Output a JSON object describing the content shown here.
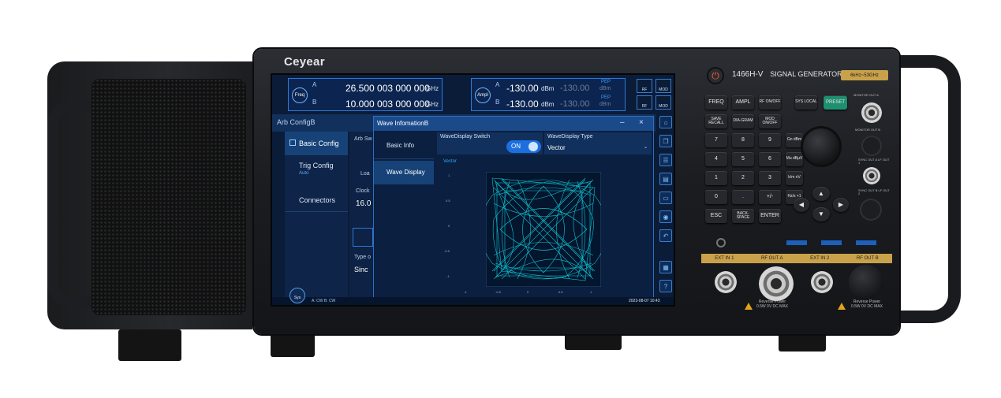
{
  "device": {
    "brand": "Ceyear",
    "model": "1466H-V",
    "model_suffix": "SIGNAL GENERATOR",
    "freq_range": "6kHz~53GHz"
  },
  "screen": {
    "freq": {
      "badge": "Freq",
      "a_label": "A",
      "a_value": "26.500 003 000 000",
      "a_unit": "GHz",
      "b_label": "B",
      "b_value": "10.000 003 000 000",
      "b_unit": "GHz"
    },
    "ampl": {
      "badge": "Ampl",
      "a_label": "A",
      "a_value": "-130.00",
      "a_unit": "dBm",
      "a_pep_label": "PEP",
      "a_pep_value": "-130.00",
      "a_pep_unit": "dBm",
      "b_label": "B",
      "b_value": "-130.00",
      "b_unit": "dBm",
      "b_pep_label": "PEP",
      "b_pep_value": "-130.00",
      "b_pep_unit": "dBm"
    },
    "mini_buttons": {
      "a_rf": "RF",
      "a_mod": "MOD",
      "b_rf": "RF",
      "b_mod": "MOD",
      "a_tag": "A",
      "b_tag": "B"
    },
    "panel_title": "Arb ConfigB",
    "left_menu": {
      "basic": "Basic Config",
      "trig": "Trig Config",
      "trig_sub": "Auto",
      "connectors": "Connectors"
    },
    "middle": {
      "arb_sw": "Arb Sw",
      "load": "Loa",
      "clock_label": "Clock",
      "clock_value": "16.0",
      "type_label": "Type o",
      "type_value": "Sinc"
    },
    "dialog": {
      "title": "Wave InfomationB",
      "tab_basic": "Basic Info",
      "tab_display": "Wave Display",
      "switch_label": "WaveDisplay Switch",
      "switch_value": "ON",
      "type_label": "WaveDisplay Type",
      "type_value": "Vector",
      "plot_label": "Vector",
      "y_ticks": [
        "1",
        "0.5",
        "0",
        "-0.5",
        "-1"
      ],
      "x_ticks": [
        "-1",
        "-0.5",
        "0",
        "0.5",
        "1"
      ]
    },
    "status": {
      "sys": "Sys",
      "channels": "A: CW  B: CW",
      "datetime": "2023-08-07 10:43"
    }
  },
  "keypad": {
    "row1": [
      "FREQ",
      "AMPL",
      "RF ON/OFF"
    ],
    "row2": [
      "SAVE RECALL",
      "DIA-GRAM",
      "MOD ON/OFF"
    ],
    "digits": [
      "7",
      "8",
      "9",
      "4",
      "5",
      "6",
      "1",
      "2",
      "3",
      "0",
      ".",
      "+/-"
    ],
    "units": [
      "Gn dBm",
      "Mu dBμV",
      "k/m nV",
      "Hz/s +1"
    ],
    "bottom": [
      "ESC",
      "BACK-SPACE",
      "ENTER"
    ],
    "sys_local": "SYS LOCAL",
    "preset": "PRESET"
  },
  "ports": {
    "monitor_a": "MONITOR OUT A",
    "monitor_b": "MONITOR OUT B",
    "sync_a": "SYNC OUT A LF OUT 1",
    "sync_b": "SYNC OUT B LF OUT 2",
    "ext_in_1": "EXT IN 1",
    "rf_out_a": "RF OUT A",
    "ext_in_2": "EXT IN 2",
    "rf_out_b": "RF OUT B",
    "reverse_a": "Reverse Power",
    "reverse_a_spec": "0.5W  0V DC MAX",
    "reverse_b": "Reverse Power",
    "reverse_b_spec": "0.5W  0V DC MAX"
  }
}
